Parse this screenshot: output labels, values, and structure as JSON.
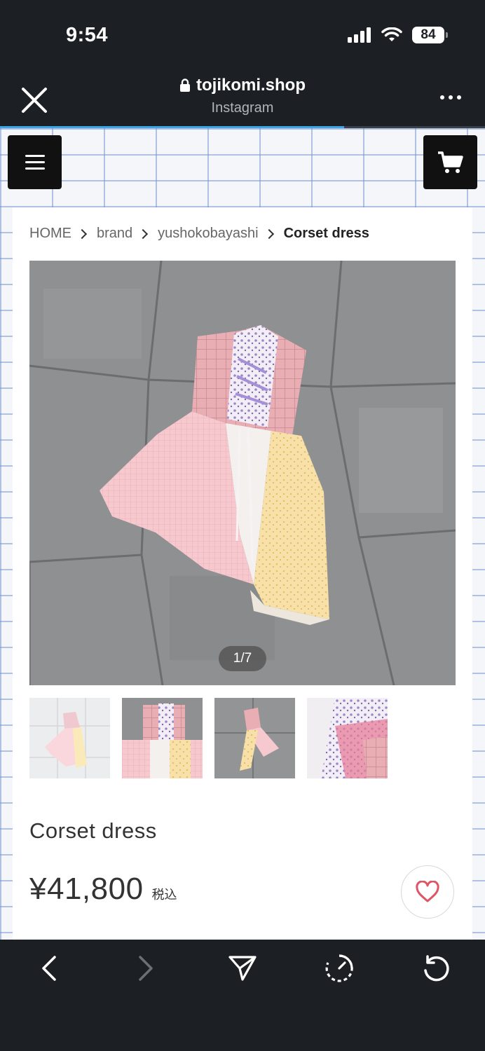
{
  "status_bar": {
    "time": "9:54",
    "battery": "84"
  },
  "browser": {
    "url": "tojikomi.shop",
    "source": "Instagram",
    "load_progress": 0.71
  },
  "breadcrumb": {
    "items": [
      "HOME",
      "brand",
      "yushokobayashi"
    ],
    "current": "Corset dress"
  },
  "gallery": {
    "counter": "1/7",
    "thumbnail_count": 4
  },
  "product": {
    "title": "Corset dress",
    "price": "¥41,800",
    "tax_label": "税込"
  },
  "icons": {
    "close": "close-icon",
    "more": "more-icon",
    "menu": "hamburger-icon",
    "cart": "cart-icon",
    "favorite": "heart-icon",
    "back": "chevron-left-icon",
    "forward": "chevron-right-icon",
    "share": "send-icon",
    "timer": "timer-icon",
    "reload": "reload-icon"
  },
  "colors": {
    "chrome": "#1c2024",
    "progress": "#3aa6e8",
    "heart": "#e05566"
  }
}
